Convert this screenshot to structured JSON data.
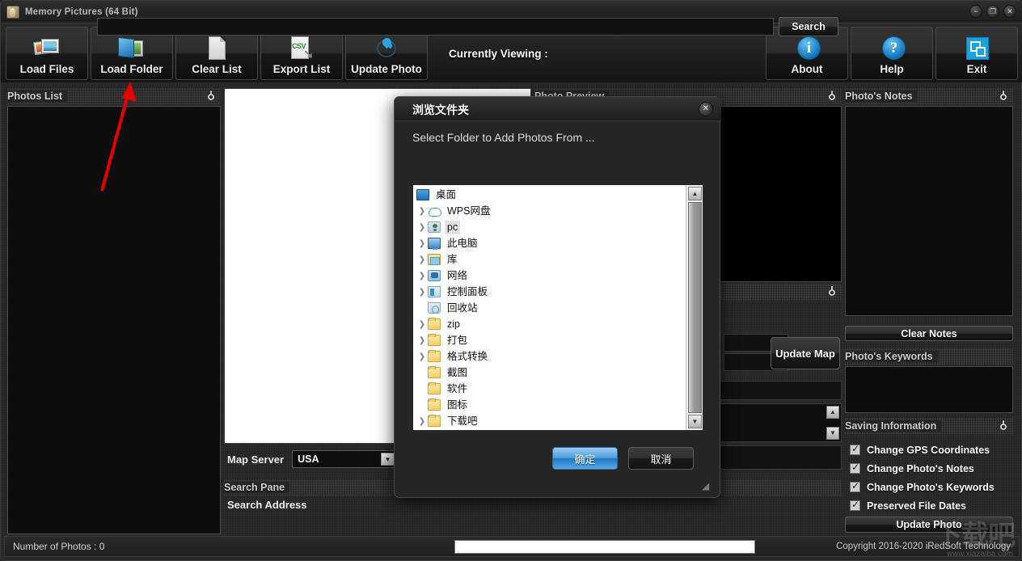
{
  "window": {
    "title": "Memory Pictures  (64 Bit)",
    "icon": "app-icon",
    "controls": {
      "minimize": "−",
      "maximize": "❐",
      "close": "✕"
    }
  },
  "toolbar": {
    "left": [
      {
        "label": "Load Files",
        "icon": "photos-icon"
      },
      {
        "label": "Load Folder",
        "icon": "folder-icon"
      },
      {
        "label": "Clear List",
        "icon": "document-icon"
      },
      {
        "label": "Export List",
        "icon": "csv-export-icon"
      },
      {
        "label": "Update Photo",
        "icon": "map-pin-icon"
      }
    ],
    "right": [
      {
        "label": "About",
        "icon": "info-icon",
        "glyph": "i"
      },
      {
        "label": "Help",
        "icon": "question-icon",
        "glyph": "?"
      },
      {
        "label": "Exit",
        "icon": "exit-icon"
      }
    ],
    "currently_viewing_label": "Currently Viewing :",
    "currently_viewing_value": ""
  },
  "panels": {
    "photos_list": {
      "title": "Photos List",
      "pin": "pin-icon"
    },
    "photo_preview": {
      "title": "Photo Preview",
      "pin": "pin-icon"
    },
    "photo_notes": {
      "title": "Photo's Notes",
      "pin": "pin-icon"
    },
    "photo_keywords": {
      "title": "Photo's Keywords",
      "pin": "pin-icon"
    },
    "saving_information": {
      "title": "Saving Information",
      "pin": "pin-icon"
    },
    "search_pane": {
      "title": "Search Pane",
      "pin": "pin-icon"
    },
    "gps_pane": {
      "title": "",
      "pin": "pin-icon"
    }
  },
  "map": {
    "server_label": "Map Server",
    "server_value": "USA",
    "server_options": [
      "USA"
    ],
    "update_map_label": "Update Map"
  },
  "search": {
    "address_label": "Search Address",
    "address_value": "",
    "button_label": "Search"
  },
  "notes": {
    "value": "",
    "clear_button": "Clear Notes"
  },
  "keywords": {
    "value": ""
  },
  "saving": {
    "options": [
      {
        "label": "Change GPS Coordinates",
        "checked": true
      },
      {
        "label": "Change Photo's Notes",
        "checked": true
      },
      {
        "label": "Change Photo's Keywords",
        "checked": true
      },
      {
        "label": "Preserved File Dates",
        "checked": true
      }
    ],
    "update_button": "Update Photo"
  },
  "statusbar": {
    "photo_count_text": "Number of Photos : 0",
    "field_value": "",
    "copyright": "Copyright 2016-2020 iRedSoft Technology"
  },
  "watermark": {
    "big": "下载吧",
    "small": "www.xiazaiba.com"
  },
  "dialog": {
    "title": "浏览文件夹",
    "prompt": "Select Folder to Add Photos From ...",
    "close": "✕",
    "ok_label": "确定",
    "cancel_label": "取消",
    "tree": [
      {
        "label": "桌面",
        "icon": "desktop-icon",
        "indent": 0,
        "expandable": false,
        "selected": false
      },
      {
        "label": "WPS网盘",
        "icon": "cloud-icon",
        "indent": 1,
        "expandable": true,
        "selected": false
      },
      {
        "label": "pc",
        "icon": "user-icon",
        "indent": 1,
        "expandable": true,
        "selected": true
      },
      {
        "label": "此电脑",
        "icon": "this-pc-icon",
        "indent": 1,
        "expandable": true,
        "selected": false
      },
      {
        "label": "库",
        "icon": "library-icon",
        "indent": 1,
        "expandable": true,
        "selected": false
      },
      {
        "label": "网络",
        "icon": "network-icon",
        "indent": 1,
        "expandable": true,
        "selected": false
      },
      {
        "label": "控制面板",
        "icon": "control-panel-icon",
        "indent": 1,
        "expandable": true,
        "selected": false
      },
      {
        "label": "回收站",
        "icon": "recycle-bin-icon",
        "indent": 1,
        "expandable": false,
        "selected": false
      },
      {
        "label": "zip",
        "icon": "folder-icon",
        "indent": 1,
        "expandable": true,
        "selected": false
      },
      {
        "label": "打包",
        "icon": "folder-icon",
        "indent": 1,
        "expandable": true,
        "selected": false
      },
      {
        "label": "格式转换",
        "icon": "folder-icon",
        "indent": 1,
        "expandable": true,
        "selected": false
      },
      {
        "label": "截图",
        "icon": "folder-icon",
        "indent": 1,
        "expandable": false,
        "selected": false
      },
      {
        "label": "软件",
        "icon": "folder-icon",
        "indent": 1,
        "expandable": false,
        "selected": false
      },
      {
        "label": "图标",
        "icon": "folder-icon",
        "indent": 1,
        "expandable": false,
        "selected": false
      },
      {
        "label": "下载吧",
        "icon": "folder-icon",
        "indent": 1,
        "expandable": true,
        "selected": false
      }
    ]
  },
  "annotation": {
    "arrow_color": "#e60000"
  },
  "colors": {
    "accent": "#16a3e0",
    "panel_bg": "#262626",
    "dark": "#0d0d0d"
  }
}
